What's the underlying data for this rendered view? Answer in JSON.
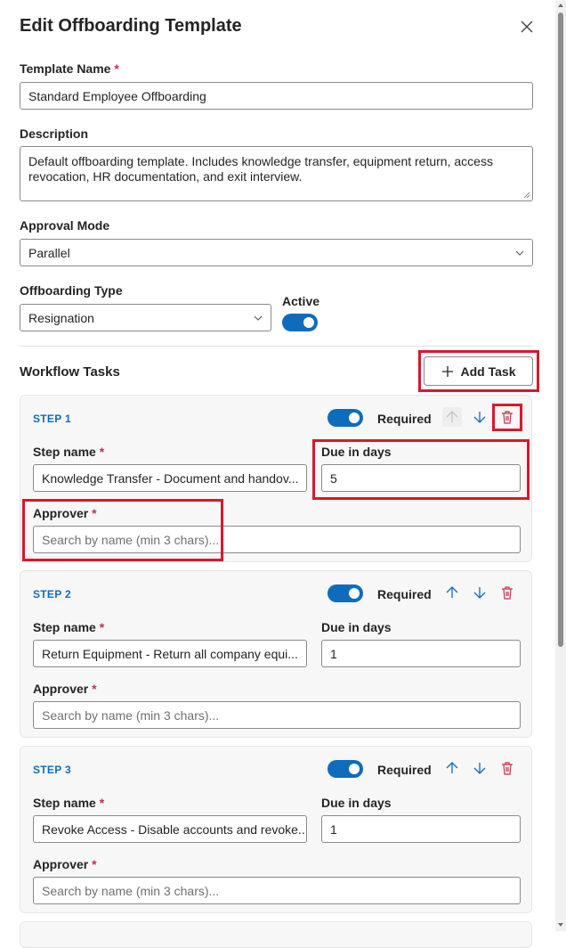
{
  "title": "Edit Offboarding Template",
  "template_name": {
    "label": "Template Name",
    "required_mark": "*",
    "value": "Standard Employee Offboarding"
  },
  "description": {
    "label": "Description",
    "value": "Default offboarding template. Includes knowledge transfer, equipment return, access revocation, HR documentation, and exit interview."
  },
  "approval_mode": {
    "label": "Approval Mode",
    "value": "Parallel"
  },
  "offboarding_type": {
    "label": "Offboarding Type",
    "value": "Resignation"
  },
  "active": {
    "label": "Active",
    "on": true
  },
  "workflow": {
    "title": "Workflow Tasks",
    "add_task_label": "Add Task"
  },
  "steps": [
    {
      "step_label": "STEP 1",
      "required_label": "Required",
      "required_on": true,
      "step_name_label": "Step name",
      "step_name_value": "Knowledge Transfer - Document and handov...",
      "due_label": "Due in days",
      "due_value": "5",
      "approver_label": "Approver",
      "approver_placeholder": "Search by name (min 3 chars)..."
    },
    {
      "step_label": "STEP 2",
      "required_label": "Required",
      "required_on": true,
      "step_name_label": "Step name",
      "step_name_value": "Return Equipment - Return all company equi...",
      "due_label": "Due in days",
      "due_value": "1",
      "approver_label": "Approver",
      "approver_placeholder": "Search by name (min 3 chars)..."
    },
    {
      "step_label": "STEP 3",
      "required_label": "Required",
      "required_on": true,
      "step_name_label": "Step name",
      "step_name_value": "Revoke Access - Disable accounts and revoke...",
      "due_label": "Due in days",
      "due_value": "1",
      "approver_label": "Approver",
      "approver_placeholder": "Search by name (min 3 chars)..."
    }
  ],
  "colors": {
    "accent": "#0f6cbd",
    "danger": "#c4314b",
    "highlight": "#d8182d"
  }
}
